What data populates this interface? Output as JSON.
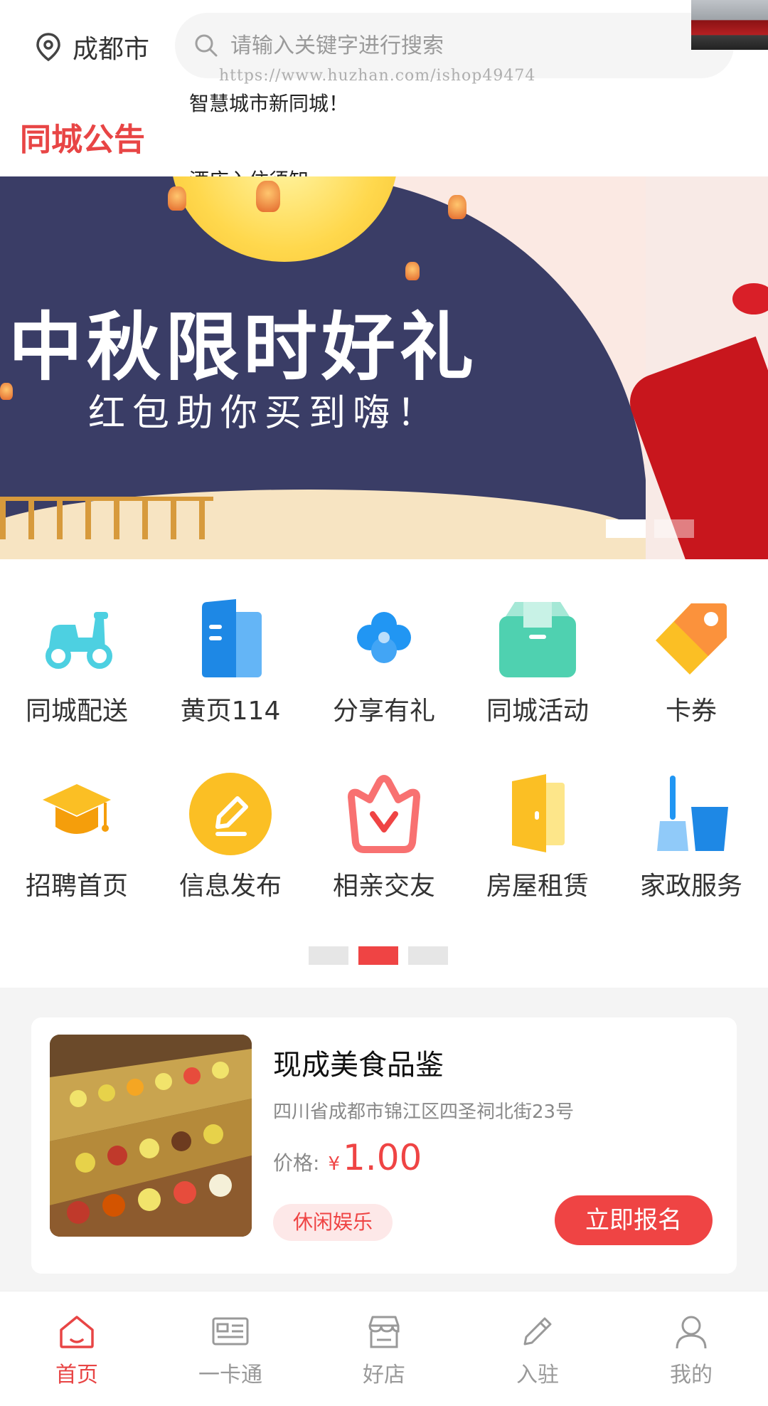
{
  "header": {
    "city": "成都市",
    "search_placeholder": "请输入关键字进行搜索",
    "watermark": "https://www.huzhan.com/ishop49474"
  },
  "notice": {
    "title": "同城公告",
    "lines": [
      "智慧城市新同城！",
      "酒店入住须知"
    ]
  },
  "banner": {
    "title": "中秋限时好礼",
    "subtitle": "红包助你买到嗨！",
    "slide_count": 2,
    "active_slide": 0
  },
  "menu": {
    "items": [
      {
        "label": "同城配送",
        "icon": "scooter-icon"
      },
      {
        "label": "黄页114",
        "icon": "building-icon"
      },
      {
        "label": "分享有礼",
        "icon": "clover-icon"
      },
      {
        "label": "同城活动",
        "icon": "box-icon"
      },
      {
        "label": "卡券",
        "icon": "tag-icon"
      },
      {
        "label": "招聘首页",
        "icon": "graduation-cap-icon"
      },
      {
        "label": "信息发布",
        "icon": "pen-icon"
      },
      {
        "label": "相亲交友",
        "icon": "heart-crown-icon"
      },
      {
        "label": "房屋租赁",
        "icon": "door-icon"
      },
      {
        "label": "家政服务",
        "icon": "broom-bucket-icon"
      }
    ],
    "page_count": 3,
    "active_page": 1
  },
  "listing": {
    "name": "现成美食品鉴",
    "address": "四川省成都市锦江区四圣祠北街23号",
    "price_label": "价格:",
    "currency": "¥",
    "price": "1.00",
    "tag": "休闲娱乐",
    "cta": "立即报名"
  },
  "tabbar": {
    "items": [
      {
        "label": "首页",
        "icon": "home-icon",
        "active": true
      },
      {
        "label": "一卡通",
        "icon": "card-icon",
        "active": false
      },
      {
        "label": "好店",
        "icon": "store-icon",
        "active": false
      },
      {
        "label": "入驻",
        "icon": "pencil-icon",
        "active": false
      },
      {
        "label": "我的",
        "icon": "user-icon",
        "active": false
      }
    ]
  },
  "colors": {
    "accent": "#ef4444",
    "notice_red": "#e84545",
    "banner_navy": "#3a3d66"
  }
}
